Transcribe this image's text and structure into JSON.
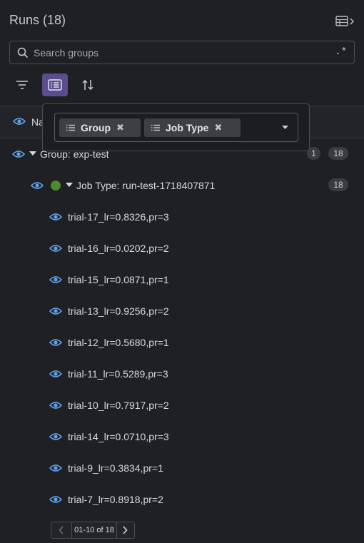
{
  "header": {
    "title": "Runs (18)",
    "panel_toggle_icon": "table-collapse-icon"
  },
  "search": {
    "placeholder": "Search groups",
    "value": "",
    "regex_label": ".*"
  },
  "toolbar": {
    "filter_icon": "filter-icon",
    "group_icon": "group-list-icon",
    "sort_icon": "sort-icon",
    "group_active": true
  },
  "table_header": {
    "name_label": "Na"
  },
  "group_popover": {
    "chips": [
      {
        "label": "Group"
      },
      {
        "label": "Job Type"
      }
    ],
    "dropdown_icon": "caret-down-icon"
  },
  "group": {
    "label": "Group: exp-test",
    "badge_a": "1",
    "badge_b": "18"
  },
  "subgroup": {
    "label": "Job Type: run-test-1718407871",
    "badge": "18",
    "status_color": "#4e8a2e"
  },
  "runs": [
    {
      "name": "trial-17_lr=0.8326,pr=3"
    },
    {
      "name": "trial-16_lr=0.0202,pr=2"
    },
    {
      "name": "trial-15_lr=0.0871,pr=1"
    },
    {
      "name": "trial-13_lr=0.9256,pr=2"
    },
    {
      "name": "trial-12_lr=0.5680,pr=1"
    },
    {
      "name": "trial-11_lr=0.5289,pr=3"
    },
    {
      "name": "trial-10_lr=0.7917,pr=2"
    },
    {
      "name": "trial-14_lr=0.0710,pr=3"
    },
    {
      "name": "trial-9_lr=0.3834,pr=1"
    },
    {
      "name": "trial-7_lr=0.8918,pr=2"
    }
  ],
  "pagination": {
    "label": "01-10 of 18"
  },
  "colors": {
    "accent": "#5b4e8e",
    "eye": "#5fa0e8",
    "background": "#1f2023"
  }
}
